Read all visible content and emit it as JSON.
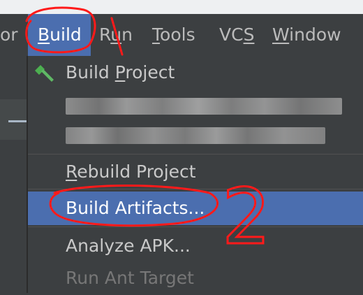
{
  "menubar": {
    "items": [
      {
        "text": "or"
      },
      {
        "pre": "",
        "mn": "B",
        "post": "uild"
      },
      {
        "pre": "R",
        "mn": "u",
        "post": "n"
      },
      {
        "pre": "",
        "mn": "T",
        "post": "ools"
      },
      {
        "pre": "VC",
        "mn": "S",
        "post": ""
      },
      {
        "pre": "",
        "mn": "W",
        "post": "indow"
      }
    ]
  },
  "dropdown": {
    "build_project": {
      "pre": "Build ",
      "mn": "P",
      "post": "roject"
    },
    "rebuild_project": {
      "pre": "",
      "mn": "R",
      "post": "ebuild Project"
    },
    "build_artifacts": "Build Artifacts...",
    "analyze_apk": "Analyze APK...",
    "run_ant_target": "Run Ant Target"
  },
  "annotation": {
    "number": "2",
    "color": "#ff1a1a"
  },
  "colors": {
    "menubar_bg": "#3c3f41",
    "highlight": "#4b6eaf",
    "annotation": "#ff1a1a"
  },
  "icons": {
    "build_project": "hammer-icon"
  }
}
